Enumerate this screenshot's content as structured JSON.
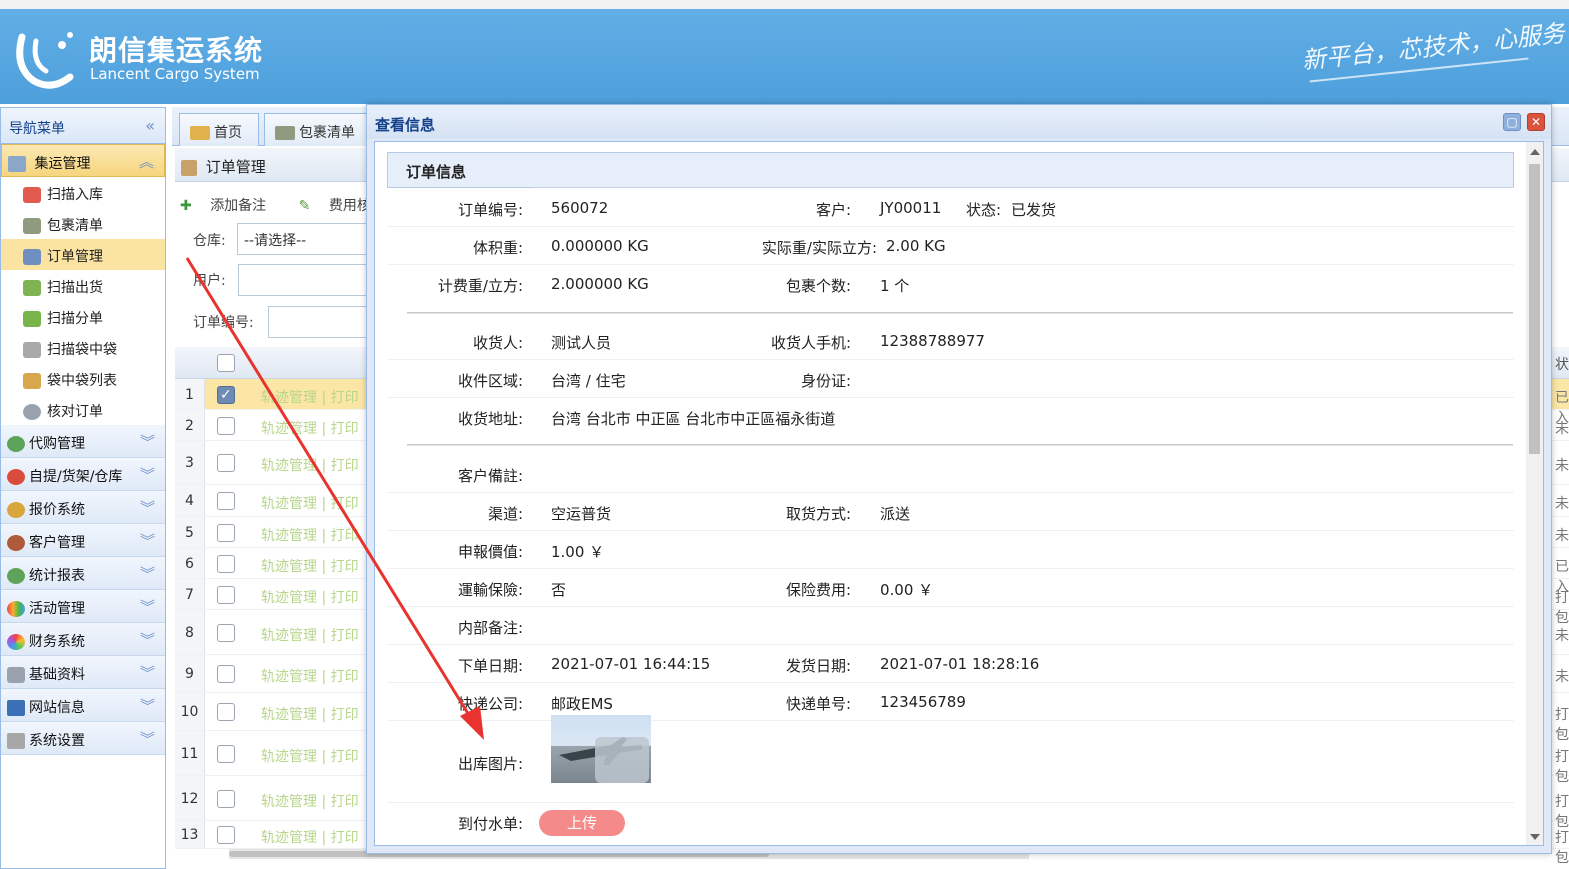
{
  "header": {
    "title": "朗信集运系统",
    "subtitle": "Lancent Cargo System",
    "slogan": "新平台，芯技术，心服务"
  },
  "nav": {
    "title": "导航菜单",
    "groups": [
      {
        "label": "集运管理",
        "active": true
      },
      {
        "label": "代购管理"
      },
      {
        "label": "自提/货架/仓库"
      },
      {
        "label": "报价系统"
      },
      {
        "label": "客户管理"
      },
      {
        "label": "统计报表"
      },
      {
        "label": "活动管理"
      },
      {
        "label": "财务系统"
      },
      {
        "label": "基础资料"
      },
      {
        "label": "网站信息"
      },
      {
        "label": "系统设置"
      }
    ],
    "sub_items": [
      "扫描入库",
      "包裹清单",
      "订单管理",
      "扫描出货",
      "扫描分单",
      "扫描袋中袋",
      "袋中袋列表",
      "核对订单"
    ],
    "selected_sub": "订单管理"
  },
  "tabs": [
    "首页",
    "包裹清单"
  ],
  "panel": {
    "title": "订单管理",
    "toolbar": [
      "添加备注",
      "费用核算"
    ],
    "warehouse_label": "仓库:",
    "warehouse_value": "--请选择--",
    "user_label": "用户:",
    "order_no_label": "订单编号:"
  },
  "grid": {
    "rows": [
      {
        "n": "1",
        "checked": true,
        "status": "已入"
      },
      {
        "n": "2",
        "status": "未"
      },
      {
        "n": "3",
        "status": "未"
      },
      {
        "n": "4",
        "status": "未"
      },
      {
        "n": "5",
        "status": "未"
      },
      {
        "n": "6",
        "status": "已入"
      },
      {
        "n": "7",
        "status": "打包"
      },
      {
        "n": "8",
        "status": "未"
      },
      {
        "n": "9",
        "status": "未"
      },
      {
        "n": "10",
        "status": "打包"
      },
      {
        "n": "11",
        "status": "打包"
      },
      {
        "n": "12",
        "status": "打包"
      },
      {
        "n": "13",
        "status": "打包"
      }
    ],
    "link1": "轨迹管理",
    "link2": "打印",
    "status_header": "状"
  },
  "dialog": {
    "title": "查看信息",
    "section": "订单信息",
    "fields": {
      "order_no_label": "订单编号:",
      "order_no": "560072",
      "customer_label": "客户:",
      "customer": "JY00011",
      "status_label": "状态:",
      "status": "已发货",
      "volume_weight_label": "体积重:",
      "volume_weight": "0.000000 KG",
      "actual_weight_label": "实际重/实际立方:",
      "actual_weight": "2.00 KG",
      "charge_weight_label": "计费重/立方:",
      "charge_weight": "2.000000 KG",
      "package_count_label": "包裹个数:",
      "package_count": "1 个",
      "receiver_label": "收货人:",
      "receiver": "测试人员",
      "receiver_phone_label": "收货人手机:",
      "receiver_phone": "12388788977",
      "area_label": "收件区域:",
      "area": "台湾 / 住宅",
      "id_card_label": "身份证:",
      "id_card": "",
      "address_label": "收货地址:",
      "address": "台湾 台北市 中正區 台北市中正區福永街道",
      "customer_note_label": "客户備註:",
      "customer_note": "",
      "channel_label": "渠道:",
      "channel": "空运普货",
      "pickup_label": "取货方式:",
      "pickup": "派送",
      "declared_label": "申報價值:",
      "declared": "1.00 ￥",
      "insurance_label": "運輸保險:",
      "insurance": "否",
      "insurance_fee_label": "保险费用:",
      "insurance_fee": "0.00 ￥",
      "internal_note_label": "内部备注:",
      "internal_note": "",
      "order_date_label": "下单日期:",
      "order_date": "2021-07-01 16:44:15",
      "ship_date_label": "发货日期:",
      "ship_date": "2021-07-01 18:28:16",
      "express_label": "快递公司:",
      "express": "邮政EMS",
      "tracking_label": "快递单号:",
      "tracking": "123456789",
      "out_photo_label": "出库图片:",
      "cod_label": "到付水单:",
      "upload_btn": "上传"
    }
  },
  "colors": {
    "header": "#4d9fdc",
    "dialog_title": "#15428b",
    "upload": "#f48a8a",
    "annotation_arrow": "#e8332f"
  }
}
